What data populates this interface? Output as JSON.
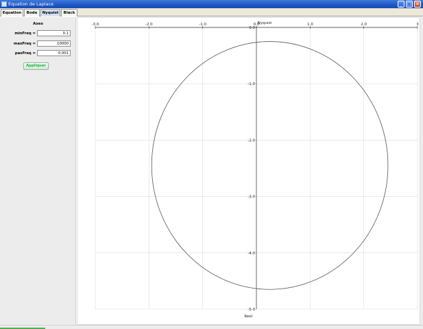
{
  "window": {
    "title": "Equation de Laplace",
    "minimize_glyph": "_",
    "maximize_glyph": "□",
    "close_glyph": "✕"
  },
  "tabs": [
    {
      "label": "Equation"
    },
    {
      "label": "Bode"
    },
    {
      "label": "Nyquist",
      "selected": true
    },
    {
      "label": "Black"
    }
  ],
  "axes_panel": {
    "title": "Axes",
    "fields": [
      {
        "label": "minFreq =",
        "value": "0.1"
      },
      {
        "label": "maxFreq =",
        "value": "10000"
      },
      {
        "label": "pasFreq =",
        "value": "0.001"
      }
    ],
    "apply_label": "Appliquer",
    "apply_color": "#22aa44"
  },
  "chart_data": {
    "type": "line",
    "title": "Nyquist",
    "xlabel": "Reel",
    "ylabel": "",
    "xlim": [
      -3.0,
      3.0
    ],
    "ylim": [
      -5.0,
      0.0
    ],
    "grid": true,
    "x_ticks": [
      "-3.0",
      "-2.0",
      "-1.0",
      "0.0",
      "1.0",
      "2.0",
      "3"
    ],
    "y_ticks": [
      {
        "value": 0.0,
        "label": "0.0"
      },
      {
        "value": -1.0,
        "label": "-1.0"
      },
      {
        "value": -2.0,
        "label": "-2.0"
      },
      {
        "value": -3.0,
        "label": "-3.0"
      },
      {
        "value": -4.0,
        "label": "-4.0"
      },
      {
        "value": -5.0,
        "label": "-5.0"
      }
    ],
    "series": [
      {
        "shape": "circle",
        "center": [
          0.25,
          -2.45
        ],
        "radius": 2.2,
        "color": "#555555"
      }
    ]
  }
}
